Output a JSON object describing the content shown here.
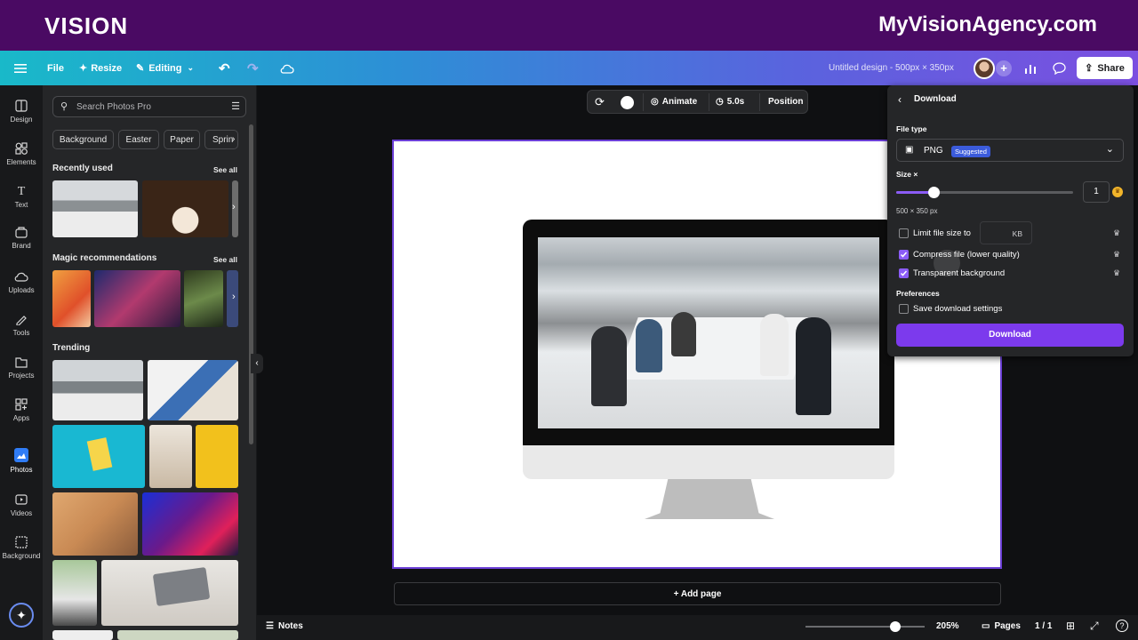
{
  "banner": {
    "logo": "VISION",
    "url": "MyVisionAgency.com"
  },
  "topbar": {
    "file": "File",
    "resize": "Resize",
    "editing": "Editing",
    "design_title": "Untitled design - 500px × 350px",
    "share": "Share"
  },
  "rail": [
    {
      "label": "Design",
      "icon": "design-icon"
    },
    {
      "label": "Elements",
      "icon": "elements-icon"
    },
    {
      "label": "Text",
      "icon": "text-icon"
    },
    {
      "label": "Brand",
      "icon": "brand-icon"
    },
    {
      "label": "Uploads",
      "icon": "uploads-icon"
    },
    {
      "label": "Tools",
      "icon": "tools-icon"
    },
    {
      "label": "Projects",
      "icon": "projects-icon"
    },
    {
      "label": "Apps",
      "icon": "apps-icon"
    },
    {
      "label": "Photos",
      "icon": "photos-icon"
    },
    {
      "label": "Videos",
      "icon": "videos-icon"
    },
    {
      "label": "Background",
      "icon": "background-icon"
    }
  ],
  "panel": {
    "search_placeholder": "Search Photos Pro",
    "chips": [
      "Background",
      "Easter",
      "Paper",
      "Sprin"
    ],
    "recently_used": "Recently used",
    "magic": "Magic recommendations",
    "trending": "Trending",
    "see_all": "See all"
  },
  "toolbar": {
    "animate": "Animate",
    "duration": "5.0s",
    "position": "Position"
  },
  "canvas": {
    "add_page": "+ Add page"
  },
  "download": {
    "title": "Download",
    "file_type_label": "File type",
    "file_type": "PNG",
    "suggested": "Suggested",
    "size_label": "Size ×",
    "size_value": "1",
    "size_fraction": 0.21,
    "dimensions": "500 × 350 px",
    "limit_label": "Limit file size to",
    "kb": "KB",
    "compress": "Compress file (lower quality)",
    "transparent": "Transparent background",
    "preferences": "Preferences",
    "save_settings": "Save download settings",
    "download_button": "Download",
    "limit_checked": false,
    "compress_checked": true,
    "transparent_checked": true,
    "save_checked": false
  },
  "bottom": {
    "notes": "Notes",
    "zoom": "205%",
    "zoom_fraction": 0.75,
    "pages": "Pages",
    "page_count": "1 / 1"
  },
  "colors": {
    "accent": "#8b5cf6",
    "banner": "#4a0a63",
    "download_button": "#7c3aed"
  }
}
